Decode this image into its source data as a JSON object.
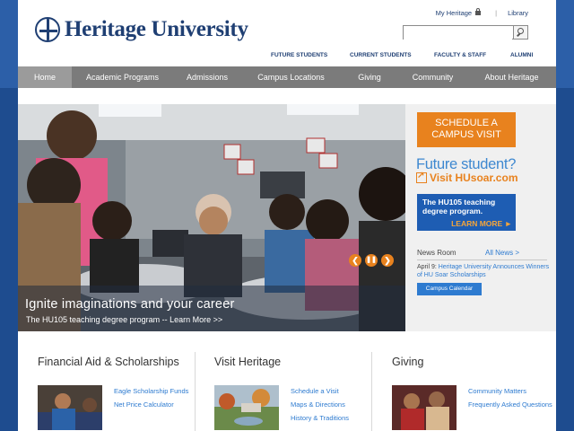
{
  "header": {
    "logo_text": "Heritage University",
    "my_heritage": "My Heritage",
    "separator": "|",
    "library": "Library",
    "search_placeholder": ""
  },
  "audience": [
    "FUTURE STUDENTS",
    "CURRENT STUDENTS",
    "FACULTY & STAFF",
    "ALUMNI"
  ],
  "nav": [
    "Home",
    "Academic Programs",
    "Admissions",
    "Campus Locations",
    "Giving",
    "Community",
    "About Heritage"
  ],
  "hero": {
    "title": "Ignite imaginations and your career",
    "subtitle": "The HU105 teaching degree program -- Learn More >>",
    "prev": "❮",
    "pause": "❚❚",
    "next": "❯"
  },
  "sidebar": {
    "schedule_line1": "SCHEDULE A",
    "schedule_line2": "CAMPUS VISIT",
    "future_line1": "Future student?",
    "future_line2": "Visit HUsoar.com",
    "promo_line1": "The HU105 teaching",
    "promo_line2": "degree program.",
    "promo_cta": "LEARN MORE ►",
    "news_heading": "News Room",
    "news_all": "All News >",
    "news_date": "April 9:",
    "news_text": " Heritage University Announces Winners of HU Soar Scholarships",
    "calendar_button": "Campus Calendar"
  },
  "columns": [
    {
      "title": "Financial Aid & Scholarships",
      "links": [
        "Eagle Scholarship Funds",
        "Net Price Calculator"
      ]
    },
    {
      "title": "Visit Heritage",
      "links": [
        "Schedule a Visit",
        "Maps & Directions",
        "History & Traditions"
      ]
    },
    {
      "title": "Giving",
      "links": [
        "Community Matters",
        "Frequently Asked Questions"
      ]
    }
  ],
  "colors": {
    "brand_navy": "#1f3f73",
    "page_blue": "#1e4c8f",
    "nav_gray": "#7b7b7b",
    "accent_orange": "#e8821e",
    "link_blue": "#2e7bd0"
  }
}
